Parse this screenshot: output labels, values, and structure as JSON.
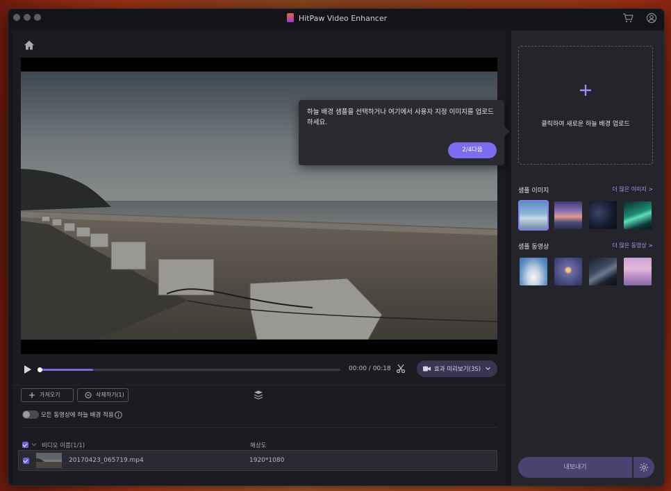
{
  "window": {
    "title": "HitPaw Video Enhancer"
  },
  "player": {
    "time": "00:00 / 00:18",
    "progress_fraction": 0.18,
    "preview_label": "효과 미리보기(3S)"
  },
  "tooltip": {
    "text": "하늘 배경 샘플을 선택하거나 여기에서 사용자 지정 이미지를 업로드하세요.",
    "next_label": "2/4다음"
  },
  "list": {
    "import_label": "가져오기",
    "delete_label": "삭제하기(1)",
    "apply_all_label": "모든 동영상에 하늘 배경 적용",
    "apply_all_on": false,
    "col_name": "비디오 이름(1/1)",
    "col_resolution": "해상도",
    "rows": [
      {
        "name": "20170423_065719.mp4",
        "resolution": "1920*1080",
        "checked": true
      }
    ]
  },
  "sidebar": {
    "upload_label": "클릭하여 새로운 하늘 배경 업로드",
    "sample_images_title": "샘플 이미지",
    "sample_images_more": "더 많은 이미지 >",
    "sample_videos_title": "샘플 동영상",
    "sample_videos_more": "더 많은 동영상 >",
    "export_label": "내보내기"
  },
  "colors": {
    "accent": "#7d6bf0",
    "panel": "#1b1b21",
    "sidebar": "#24242b"
  }
}
